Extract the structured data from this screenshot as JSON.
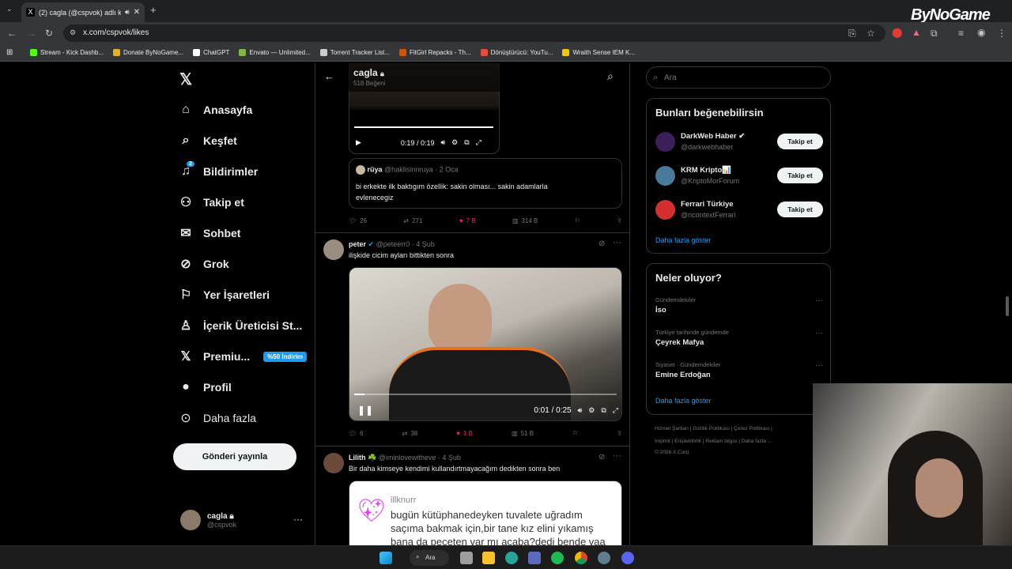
{
  "browser": {
    "tab_title": "(2) cagla (@cspvok) adlı kul",
    "url": "x.com/cspvok/likes",
    "bookmarks": [
      {
        "label": "Stream - Kick Dashb...",
        "color": "#53fc18"
      },
      {
        "label": "Donate ByNoGame...",
        "color": "#e1b12c"
      },
      {
        "label": "ChatGPT",
        "color": "#ffffff"
      },
      {
        "label": "Envato — Unlimited...",
        "color": "#82b541"
      },
      {
        "label": "Torrent Tracker List...",
        "color": "#cccccc"
      },
      {
        "label": "FitGirl Repacks - Th...",
        "color": "#d35400"
      },
      {
        "label": "Dönüştürücü: YouTu...",
        "color": "#e74c3c"
      },
      {
        "label": "Wraith Sense IEM K...",
        "color": "#f1c40f"
      }
    ],
    "watermark": "ByNoGame"
  },
  "nav": {
    "items": [
      {
        "label": "Anasayfa",
        "icon": "home-icon",
        "glyph": "⌂"
      },
      {
        "label": "Keşfet",
        "icon": "search-icon",
        "glyph": "⌕"
      },
      {
        "label": "Bildirimler",
        "icon": "bell-icon",
        "glyph": "🔔︎"
      },
      {
        "label": "Takip et",
        "icon": "follow-icon",
        "glyph": "⚇"
      },
      {
        "label": "Sohbet",
        "icon": "mail-icon",
        "glyph": "✉"
      },
      {
        "label": "Grok",
        "icon": "grok-icon",
        "glyph": "⊘"
      },
      {
        "label": "Yer İşaretleri",
        "icon": "bookmark-icon",
        "glyph": "⚐"
      },
      {
        "label": "İçerik Üreticisi St...",
        "icon": "creator-icon",
        "glyph": "♙"
      },
      {
        "label": "Premiu...",
        "icon": "x-icon",
        "glyph": "𝕏"
      },
      {
        "label": "Profil",
        "icon": "profile-icon",
        "glyph": "●"
      },
      {
        "label": "Daha fazla",
        "icon": "more-icon",
        "glyph": "⊙"
      }
    ],
    "notifications_badge": "2",
    "premium_badge": "%50 İndirim",
    "post_button": "Gönderi yayınla",
    "user_name": "cagla",
    "user_handle": "@cspvok"
  },
  "timeline": {
    "header_name": "cagla",
    "header_sub": "518 Beğeni",
    "tweet1": {
      "video_time": "0:19 / 0:19",
      "quote_name": "rüya",
      "quote_handle": "@haklisinnruya · 2 Oca",
      "quote_text_1": "bi erkekte ilk baktıgım özellik: sakin olması... sakin adamlarla",
      "quote_text_2": "evlenecegiz",
      "replies": "26",
      "retweets": "271",
      "likes": "7 B",
      "views": "314 B"
    },
    "tweet2": {
      "name": "peter",
      "handle": "@peteerr0 · 4 Şub",
      "text": "ilişkide cicim ayları bittikten sonra",
      "video_time": "0:01 / 0:25",
      "video_progress": 0.04,
      "replies": "6",
      "retweets": "38",
      "likes": "1 B",
      "views": "51 B"
    },
    "tweet3": {
      "name": "Lilith ☘️",
      "handle": "@iminlovewitheve · 4 Şub",
      "text": "Bir daha kimseye kendimi kullandırtmayacağım dedikten sonra ben",
      "img_user": "illknurr",
      "img_line1": "bugün kütüphanedeyken tuvalete uğradım",
      "img_line2": "saçıma bakmak için,bir tane kız elini yıkamış",
      "img_line3": "bana da peçeten var mı acaba?dedi bende vaa"
    }
  },
  "right": {
    "search_placeholder": "Ara",
    "suggest_title": "Bunları beğenebilirsin",
    "suggestions": [
      {
        "name": "DarkWeb Haber ✔",
        "handle": "@darkwebhaber",
        "color": "#3b1e5a"
      },
      {
        "name": "KRM Kripto📊",
        "handle": "@KriptoMorForum",
        "color": "#4a7a9a"
      },
      {
        "name": "Ferrari Türkiye",
        "handle": "@ncontextFerrari",
        "color": "#d32f2f"
      }
    ],
    "follow_label": "Takip et",
    "show_more": "Daha fazla göster",
    "trends_title": "Neler oluyor?",
    "trends": [
      {
        "context": "Gündemdekiler",
        "title": "İso"
      },
      {
        "context": "Türkiye tarihinde gündemde",
        "title": "Çeyrek Mafya"
      },
      {
        "context": "Siyaset · Gündemdekiler",
        "title": "Emine Erdoğan"
      }
    ],
    "footer1": "Hizmet Şartları  |  Gizlilik Politikası  |  Çerez Politikası  |",
    "footer2": "Imprint  |  Erişilebilirlik  |  Reklam bilgisi  |  Daha fazla ...",
    "footer3": "© 2026 X Corp."
  },
  "taskbar": {
    "search": "Ara"
  }
}
